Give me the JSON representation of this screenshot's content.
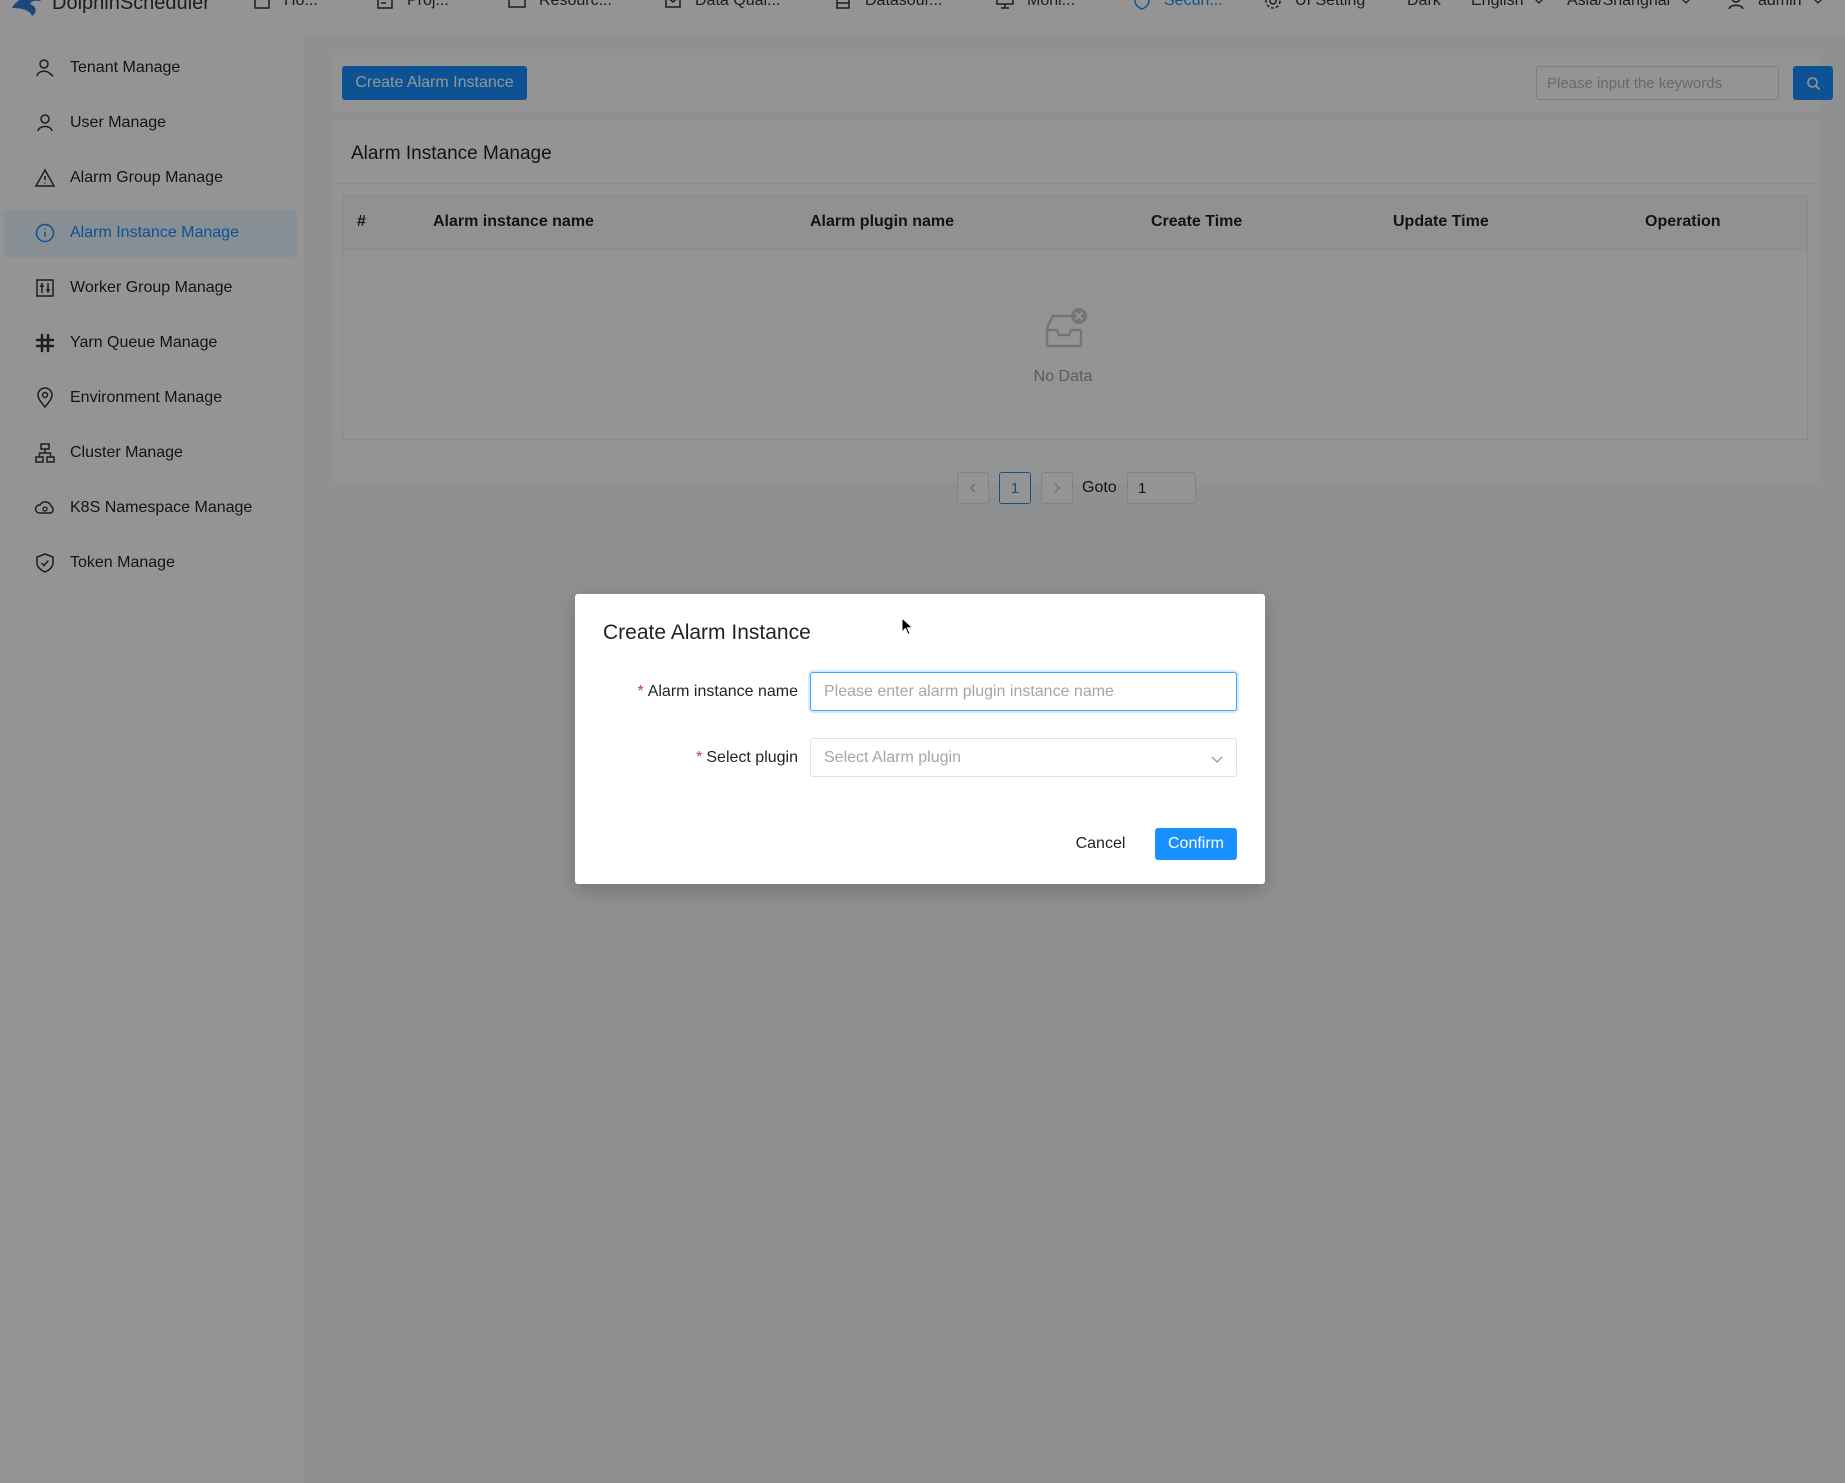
{
  "app": {
    "brand": "DolphinScheduler"
  },
  "nav": {
    "items": [
      {
        "label": "Ho...",
        "icon": "home-icon"
      },
      {
        "label": "Proj...",
        "icon": "project-icon"
      },
      {
        "label": "Resourc...",
        "icon": "folder-icon"
      },
      {
        "label": "Data Qual...",
        "icon": "data-quality-icon"
      },
      {
        "label": "Datasour...",
        "icon": "database-icon"
      },
      {
        "label": "Moni...",
        "icon": "monitor-icon"
      },
      {
        "label": "Securi...",
        "icon": "security-icon",
        "active": true
      },
      {
        "label": "UI Setting",
        "icon": "settings-icon"
      }
    ],
    "theme": "Dark",
    "language": "English",
    "timezone": "Asia/Shanghai",
    "user": "admin"
  },
  "sidebar": {
    "items": [
      {
        "label": "Tenant Manage",
        "icon": "tenant-icon"
      },
      {
        "label": "User Manage",
        "icon": "user-icon"
      },
      {
        "label": "Alarm Group Manage",
        "icon": "warning-icon"
      },
      {
        "label": "Alarm Instance Manage",
        "icon": "info-icon",
        "active": true
      },
      {
        "label": "Worker Group Manage",
        "icon": "worker-group-icon"
      },
      {
        "label": "Yarn Queue Manage",
        "icon": "slack-icon"
      },
      {
        "label": "Environment Manage",
        "icon": "location-icon"
      },
      {
        "label": "Cluster Manage",
        "icon": "cluster-icon"
      },
      {
        "label": "K8S Namespace Manage",
        "icon": "cloud-icon"
      },
      {
        "label": "Token Manage",
        "icon": "safety-icon"
      }
    ]
  },
  "toolbar": {
    "create_label": "Create Alarm Instance",
    "search_placeholder": "Please input the keywords"
  },
  "table": {
    "title": "Alarm Instance Manage",
    "columns": [
      "#",
      "Alarm instance name",
      "Alarm plugin name",
      "Create Time",
      "Update Time",
      "Operation"
    ],
    "rows": [],
    "empty_text": "No Data"
  },
  "pagination": {
    "current_page": "1",
    "goto_label": "Goto",
    "goto_value": "1"
  },
  "modal": {
    "title": "Create Alarm Instance",
    "name_label": "Alarm instance name",
    "name_placeholder": "Please enter alarm plugin instance name",
    "name_value": "",
    "plugin_label": "Select plugin",
    "plugin_placeholder": "Select Alarm plugin",
    "required_mark": "*",
    "cancel_label": "Cancel",
    "confirm_label": "Confirm"
  },
  "colors": {
    "primary": "#1890ff",
    "required": "#d03050",
    "active_bg": "#e8f4ff"
  }
}
